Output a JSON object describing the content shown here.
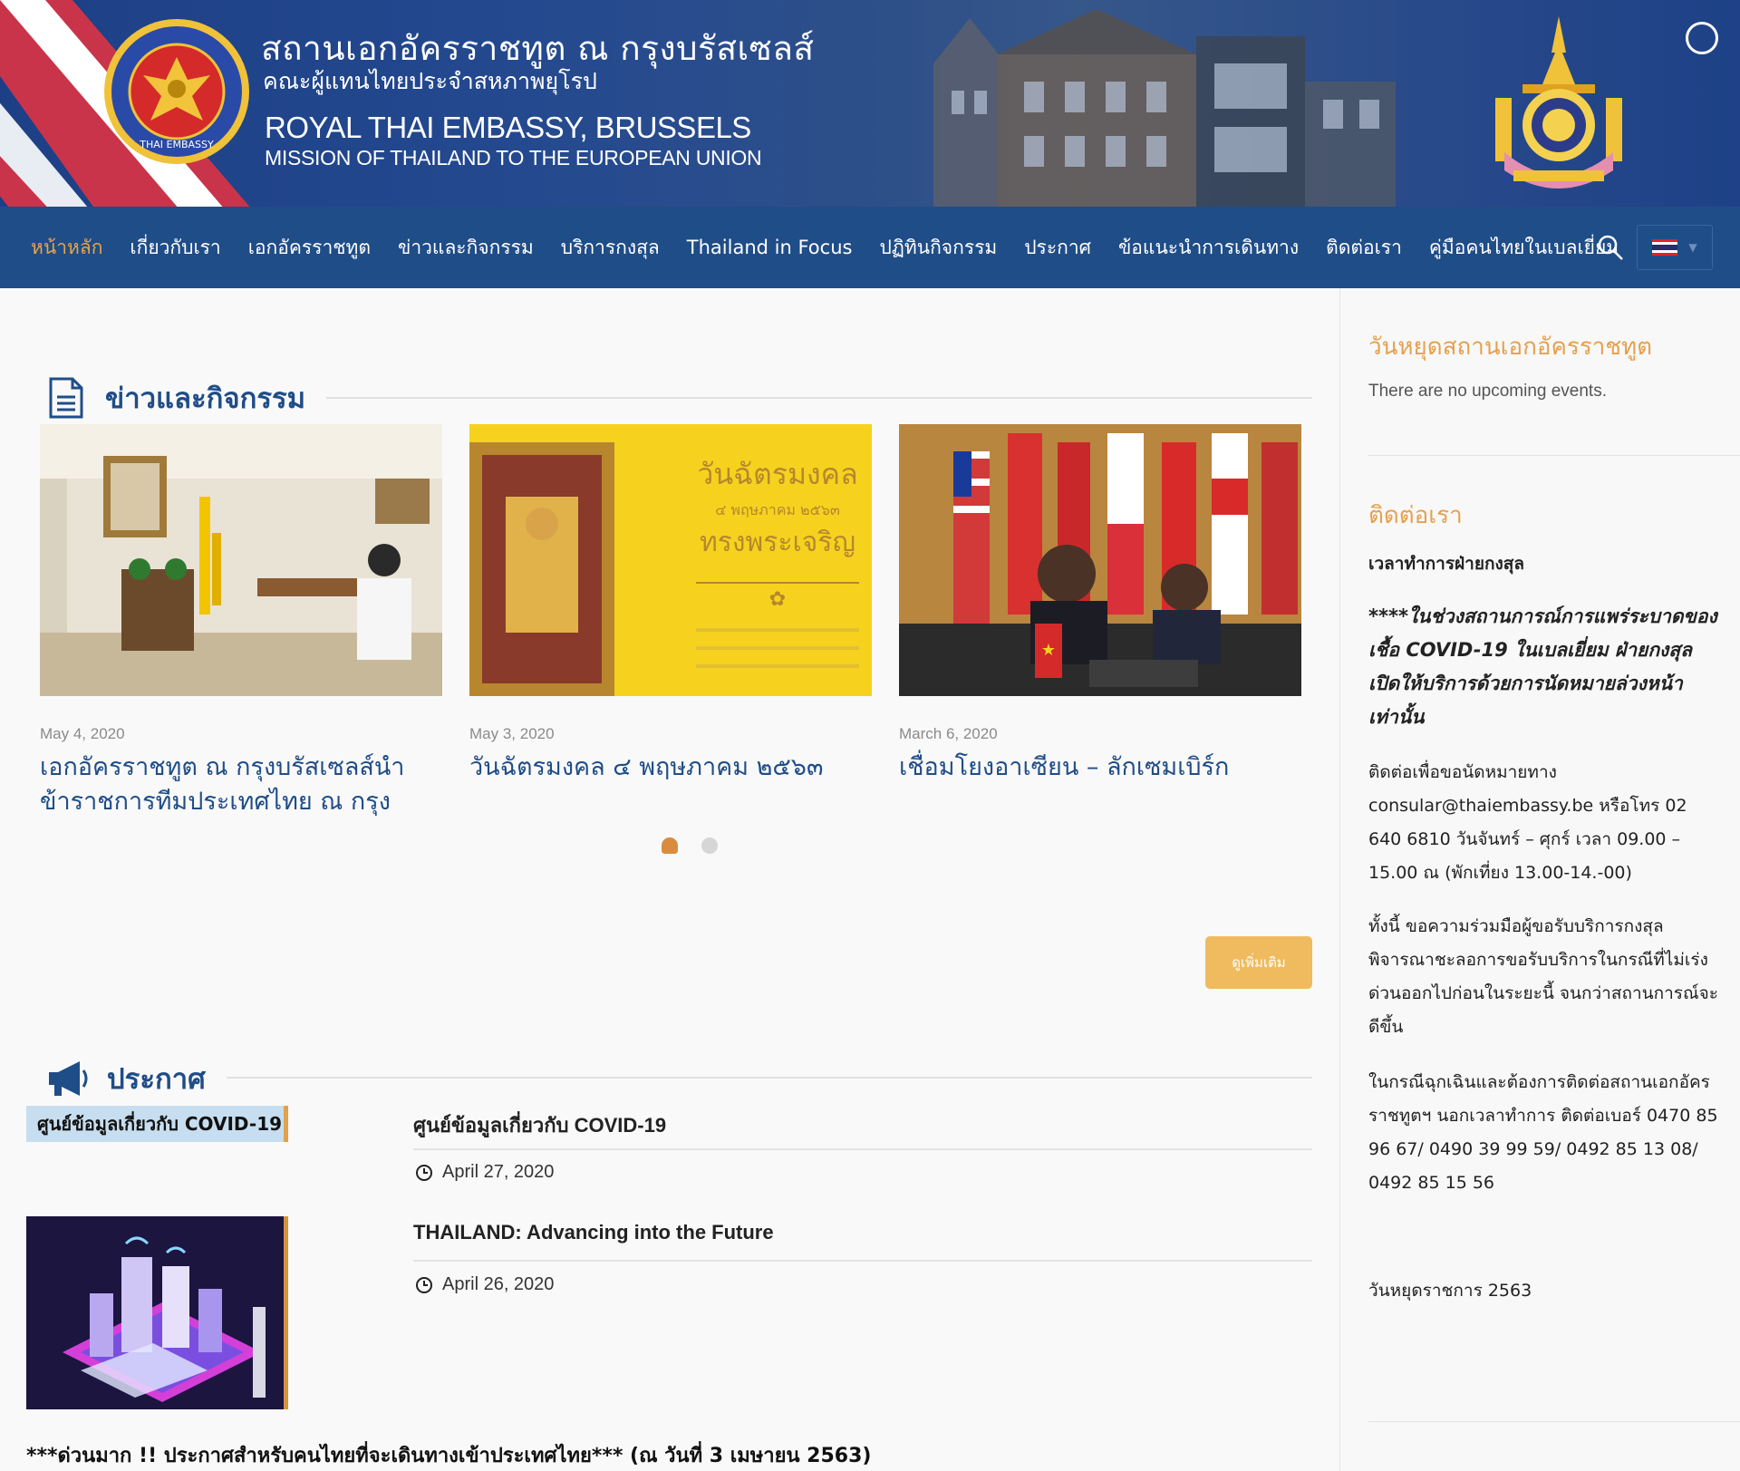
{
  "header": {
    "title_th": "สถานเอกอัครราชทูต ณ กรุงบรัสเซลส์",
    "subtitle_th": "คณะผู้แทนไทยประจำสหภาพยุโรป",
    "title_en": "ROYAL THAI EMBASSY, BRUSSELS",
    "subtitle_en": "MISSION OF THAILAND TO THE EUROPEAN UNION",
    "seal_text": "ROYAL THAI EMBASSY"
  },
  "nav": {
    "items": [
      {
        "label": "หน้าหลัก",
        "active": true
      },
      {
        "label": "เกี่ยวกับเรา"
      },
      {
        "label": "เอกอัครราชทูต"
      },
      {
        "label": "ข่าวและกิจกรรม"
      },
      {
        "label": "บริการกงสุล"
      },
      {
        "label": "Thailand in Focus"
      },
      {
        "label": "ปฏิทินกิจกรรม"
      },
      {
        "label": "ประกาศ"
      },
      {
        "label": "ข้อแนะนำการเดินทาง"
      },
      {
        "label": "ติดต่อเรา"
      },
      {
        "label": "คู่มือคนไทยในเบลเยี่ยม"
      }
    ],
    "search_icon": "search-icon",
    "language_flag": "thai-flag"
  },
  "news": {
    "heading": "ข่าวและกิจกรรม",
    "icon": "document-icon",
    "cards": [
      {
        "date": "May 4, 2020",
        "title": "เอกอัครราชทูต ณ กรุงบรัสเซลส์นำข้าราชการทีมประเทศไทย ณ กรุง"
      },
      {
        "date": "May 3, 2020",
        "title": "วันฉัตรมงคล ๔ พฤษภาคม ๒๕๖๓",
        "image_text": {
          "line1": "วันฉัตรมงคล",
          "line2": "๔ พฤษภาคม ๒๕๖๓",
          "line3": "ทรงพระเจริญ"
        }
      },
      {
        "date": "March 6, 2020",
        "title": "เชื่อมโยงอาเซียน – ลักเซมเบิร์ก"
      }
    ],
    "more_label": "ดูเพิ่มเติม"
  },
  "announcements": {
    "heading": "ประกาศ",
    "icon": "megaphone-icon",
    "tag": "ศูนย์ข้อมูลเกี่ยวกับ COVID-19",
    "items": [
      {
        "title": "ศูนย์ข้อมูลเกี่ยวกับ COVID-19",
        "date": "April 27, 2020"
      },
      {
        "title": "THAILAND: Advancing into the Future",
        "date": "April 26, 2020"
      }
    ],
    "bottom_note": "***ด่วนมาก !! ประกาศสำหรับคนไทยที่จะเดินทางเข้าประเทศไทย*** (ณ วันที่ 3 เมษายน 2563)"
  },
  "sidebar": {
    "holidays_heading": "วันหยุดสถานเอกอัครราชทูต",
    "no_events": "There are no upcoming events.",
    "contact_heading": "ติดต่อเรา",
    "hours_label": "เวลาทำการฝ่ายกงสุล",
    "covid_notice": "****ในช่วงสถานการณ์การแพร่ระบาดของเชื้อ COVID-19 ในเบลเยี่ยม ฝ่ายกงสุลเปิดให้บริการด้วยการนัดหมายล่วงหน้าเท่านั้น",
    "appointment": "ติดต่อเพื่อขอนัดหมายทาง consular@thaiembassy.be หรือโทร 02 640 6810 วันจันทร์ – ศุกร์ เวลา 09.00 – 15.00 ณ (พักเที่ยง 13.00-14.-00)",
    "cooperation": "ทั้งนี้ ขอความร่วมมือผู้ขอรับบริการกงสุลพิจารณาชะลอการขอรับบริการในกรณีที่ไม่เร่งด่วนออกไปก่อนในระยะนี้ จนกว่าสถานการณ์จะดีขึ้น",
    "emergency": "ในกรณีฉุกเฉินและต้องการติดต่อสถานเอกอัครราชทูตฯ นอกเวลาทำการ ติดต่อเบอร์ 0470 85 96 67/ 0490 39 99 59/ 0492 85 13 08/ 0492 85 15 56",
    "public_holidays": "วันหยุดราชการ 2563"
  },
  "colors": {
    "nav_bg": "#1f4d88",
    "accent_orange": "#e6a04c",
    "link_blue": "#1f4d88",
    "button_bg": "#f0bb5f"
  }
}
